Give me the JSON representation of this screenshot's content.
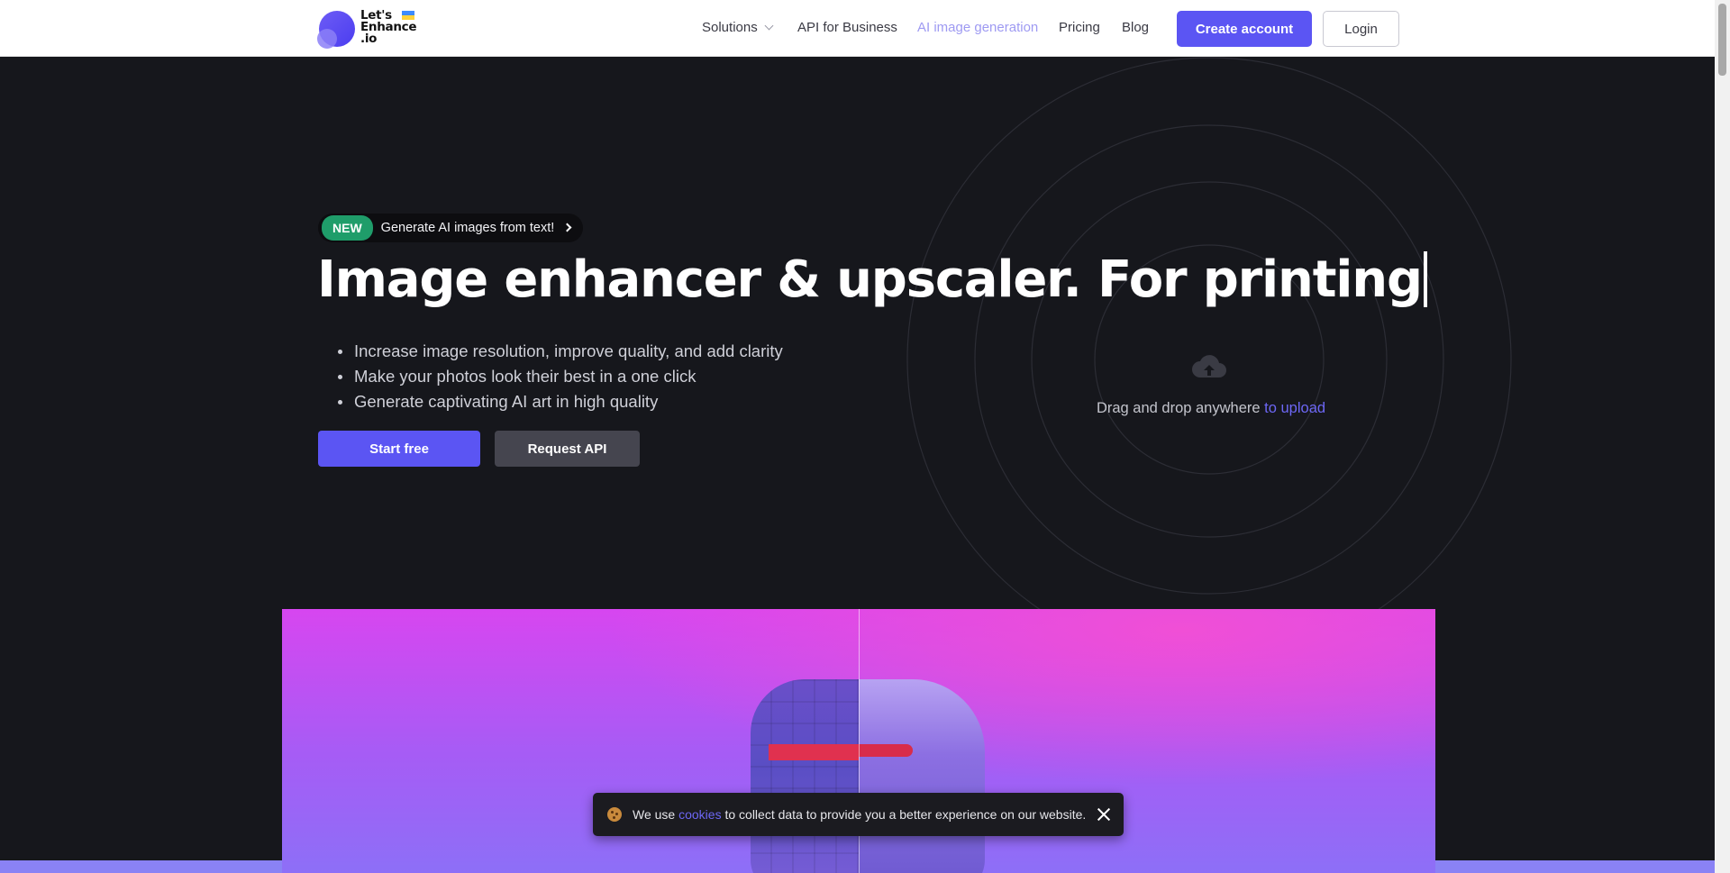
{
  "header": {
    "logo": {
      "line1": "Let's",
      "line2": "Enhance",
      "line3": ".io"
    },
    "nav": [
      {
        "label": "Solutions"
      },
      {
        "label": "API for Business"
      },
      {
        "label": "AI image generation"
      },
      {
        "label": "Pricing"
      },
      {
        "label": "Blog"
      }
    ],
    "create_account": "Create account",
    "login": "Login"
  },
  "hero": {
    "badge_new": "NEW",
    "badge_text": "Generate AI images from text!",
    "title": "Image enhancer & upscaler. For printing",
    "bullets": [
      "Increase image resolution, improve quality, and add clarity",
      "Make your photos look their best in a one click",
      "Generate captivating AI art in high quality"
    ],
    "start_free": "Start free",
    "request_api": "Request API"
  },
  "upload": {
    "text": "Drag and drop anywhere",
    "link": "to upload",
    "icon": "cloud-upload-icon"
  },
  "cookie": {
    "prefix": "We use",
    "link": "cookies",
    "suffix": "to collect data to provide you a better experience on our website."
  },
  "colors": {
    "accent": "#5b55f3",
    "background": "#16171c",
    "badge_green": "#1f9d6a",
    "active_nav": "#9e9af2"
  }
}
